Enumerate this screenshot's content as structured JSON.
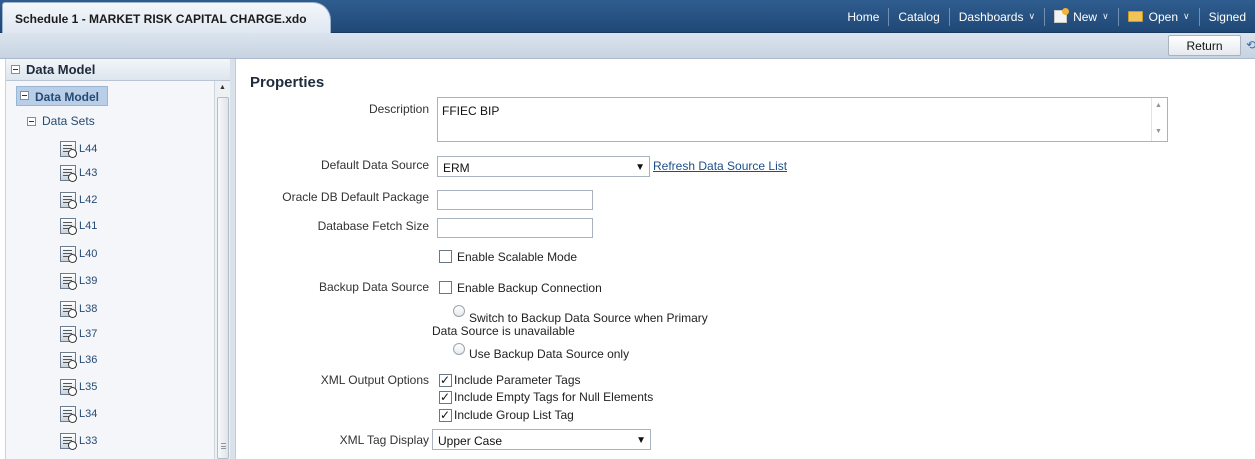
{
  "header": {
    "doc_title": "Schedule 1 - MARKET RISK CAPITAL CHARGE.xdo",
    "nav": {
      "home": "Home",
      "catalog": "Catalog",
      "dashboards": "Dashboards",
      "new": "New",
      "open": "Open",
      "signed": "Signed"
    }
  },
  "toolbar": {
    "return_label": "Return"
  },
  "sidebar": {
    "title": "Data Model",
    "root": "Data Model",
    "datasets_label": "Data Sets",
    "items": [
      "L44",
      "L43",
      "L42",
      "L41",
      "L40",
      "L39",
      "L38",
      "L37",
      "L36",
      "L35",
      "L34",
      "L33"
    ]
  },
  "main": {
    "title": "Properties",
    "description_label": "Description",
    "description_value": "FFIEC BIP",
    "default_ds_label": "Default Data Source",
    "default_ds_value": "ERM",
    "refresh_link": "Refresh Data Source List",
    "oracle_pkg_label": "Oracle DB Default Package",
    "fetch_size_label": "Database Fetch Size",
    "scalable_label": "Enable Scalable Mode",
    "backup_ds_label": "Backup Data Source",
    "backup_conn_label": "Enable Backup Connection",
    "switch_backup_line1": "Switch to Backup Data Source when Primary",
    "switch_backup_line2": "Data Source is unavailable",
    "use_backup_only": "Use Backup Data Source only",
    "xml_output_label": "XML Output Options",
    "include_param_tags": "Include Parameter Tags",
    "include_empty_tags": "Include Empty Tags for Null Elements",
    "include_group_list": "Include Group List Tag",
    "xml_tag_display_label": "XML Tag Display",
    "xml_tag_display_value": "Upper Case"
  },
  "state": {
    "scalable_checked": false,
    "backup_conn_checked": false,
    "include_param_tags_checked": true,
    "include_empty_tags_checked": true,
    "include_group_list_checked": true
  }
}
